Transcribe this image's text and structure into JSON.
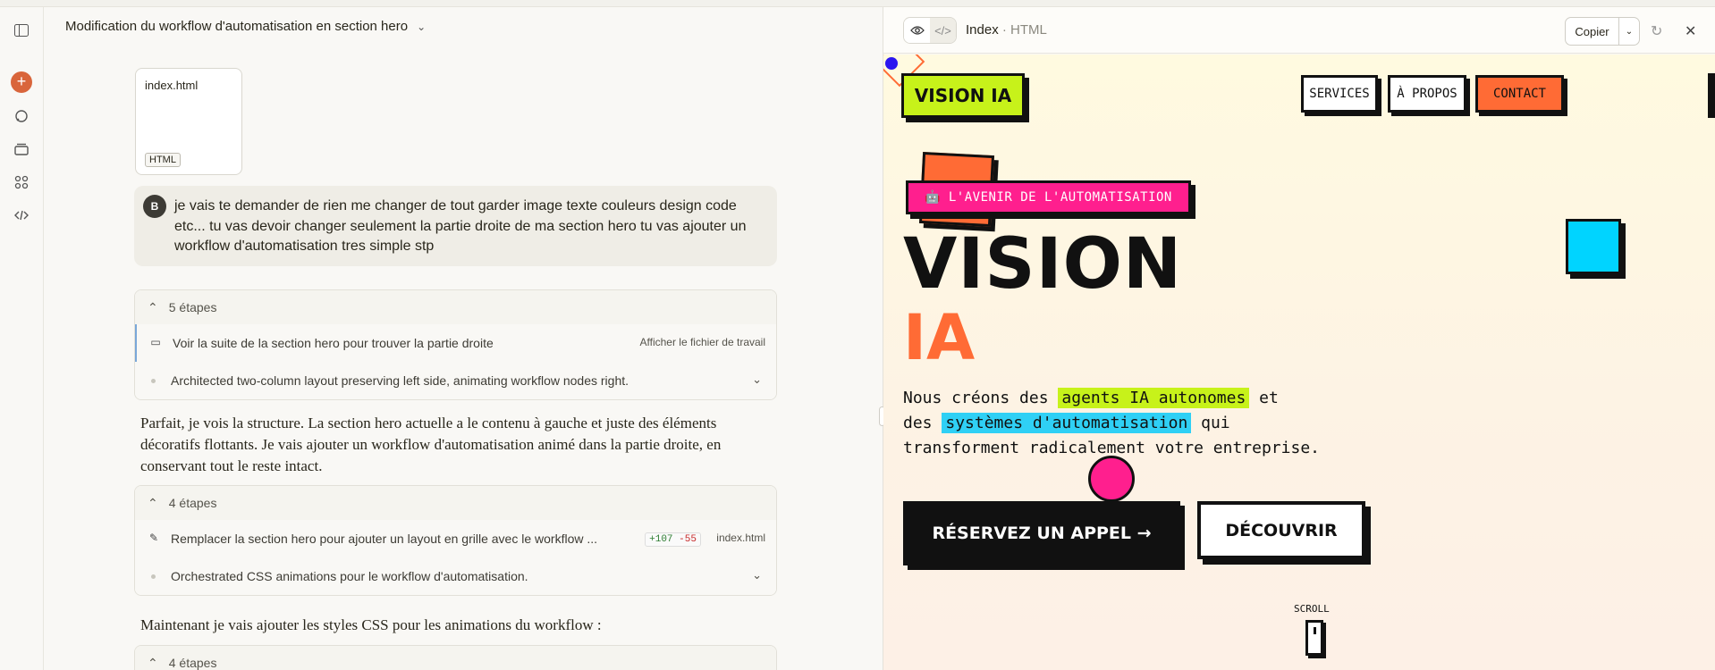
{
  "chat": {
    "title": "Modification du workflow d'automatisation en section hero",
    "file_card": {
      "name": "index.html",
      "tag": "HTML"
    },
    "user": {
      "avatar": "B",
      "message": "je vais te demander de rien me changer de tout garder image texte couleurs design code etc... tu vas devoir changer seulement la partie droite de ma section hero tu vas ajouter un workflow d'automatisation tres simple stp"
    },
    "steps1": {
      "header": "5 étapes",
      "row1": "Voir la suite de la section hero pour trouver la partie droite",
      "row1_right": "Afficher le fichier de travail",
      "row2": "Architected two-column layout preserving left side, animating workflow nodes right."
    },
    "assistant1": "Parfait, je vois la structure. La section hero actuelle a le contenu à gauche et juste des éléments décoratifs flottants. Je vais ajouter un workflow d'automatisation animé dans la partie droite, en conservant tout le reste intact.",
    "steps2": {
      "header": "4 étapes",
      "row1": "Remplacer la section hero pour ajouter un layout en grille avec le workflow ...",
      "added": "+107",
      "removed": "-55",
      "file": "index.html",
      "row2": "Orchestrated CSS animations pour le workflow d'automatisation."
    },
    "assistant2": "Maintenant je vais ajouter les styles CSS pour les animations du workflow :",
    "steps3": {
      "header": "4 étapes"
    }
  },
  "artifact": {
    "title": "Index",
    "subtitle": "· HTML",
    "copy_label": "Copier"
  },
  "preview": {
    "logo": "VISION IA",
    "nav": [
      "SERVICES",
      "À PROPOS",
      "CONTACT"
    ],
    "badge": "🤖 L'AVENIR DE L'AUTOMATISATION",
    "headline1": "VISION",
    "headline2": "IA",
    "para": {
      "p1": "Nous créons des ",
      "h1": "agents IA autonomes",
      "p2": " et",
      "p3": "des ",
      "h2": "systèmes d'automatisation",
      "p4": " qui",
      "p5": "transforment radicalement votre entreprise."
    },
    "cta_primary": "RÉSERVEZ UN APPEL →",
    "cta_secondary": "DÉCOUVRIR",
    "scroll": "SCROLL"
  },
  "colors": {
    "lime": "#c7f21a",
    "orange": "#ff6b35",
    "pink": "#ff1f8e",
    "cyan": "#00d4ff",
    "claude_accent": "#d9653b"
  },
  "icons": [
    "sidebar-toggle-icon",
    "new-chat-icon",
    "chats-icon",
    "projects-icon",
    "artifacts-icon",
    "code-icon",
    "eye-icon",
    "code-view-icon",
    "refresh-icon",
    "close-icon",
    "chevron-down-icon",
    "pencil-icon",
    "file-icon"
  ]
}
